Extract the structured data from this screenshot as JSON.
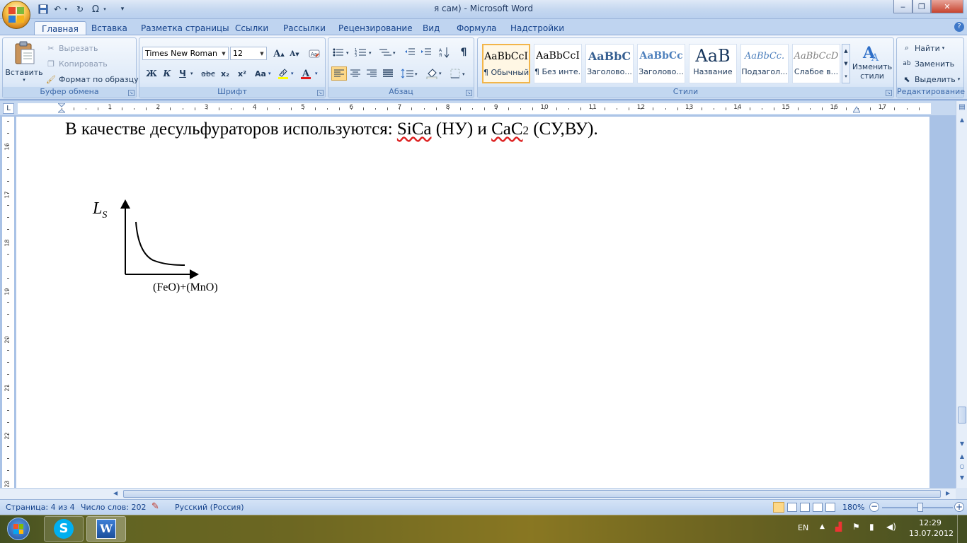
{
  "window": {
    "title": "я сам) - Microsoft Word",
    "min": "‒",
    "max": "❐",
    "close": "✕"
  },
  "tabs": [
    {
      "label": "Главная",
      "active": true
    },
    {
      "label": "Вставка"
    },
    {
      "label": "Разметка страницы"
    },
    {
      "label": "Ссылки"
    },
    {
      "label": "Рассылки"
    },
    {
      "label": "Рецензирование"
    },
    {
      "label": "Вид"
    },
    {
      "label": "Формула"
    },
    {
      "label": "Надстройки"
    }
  ],
  "clipboard": {
    "group": "Буфер обмена",
    "paste": "Вставить",
    "cut": "Вырезать",
    "copy": "Копировать",
    "format_painter": "Формат по образцу"
  },
  "font": {
    "group": "Шрифт",
    "name": "Times New Roman",
    "size": "12",
    "bold": "Ж",
    "italic": "К",
    "underline": "Ч",
    "strike": "abc",
    "sub": "x₂",
    "sup": "x²",
    "case": "Aa",
    "grow": "A",
    "shrink": "A"
  },
  "paragraph": {
    "group": "Абзац",
    "pilcrow": "¶"
  },
  "styles": {
    "group": "Стили",
    "change": "Изменить стили",
    "tiles": [
      {
        "sample": "AaBbCcI",
        "name": "¶ Обычный"
      },
      {
        "sample": "AaBbCcI",
        "name": "¶ Без инте..."
      },
      {
        "sample": "AaBbC",
        "name": "Заголово..."
      },
      {
        "sample": "AaBbCc",
        "name": "Заголово..."
      },
      {
        "sample": "AaB",
        "name": "Название"
      },
      {
        "sample": "AaBbCc.",
        "name": "Подзагол..."
      },
      {
        "sample": "AaBbCcD",
        "name": "Слабое в..."
      }
    ]
  },
  "editing": {
    "group": "Редактирование",
    "find": "Найти",
    "replace": "Заменить",
    "select": "Выделить"
  },
  "ruler": {
    "h_ticks": [
      "1",
      "2",
      "3",
      "4",
      "5",
      "6",
      "7",
      "8",
      "9",
      "10",
      "11",
      "12",
      "13",
      "14",
      "15",
      "16",
      "17"
    ],
    "v_ticks": [
      "16",
      "17",
      "18",
      "19",
      "20",
      "21",
      "22",
      "23"
    ]
  },
  "document": {
    "line_pre": "В качестве десульфураторов используются: ",
    "sica": "SiCa",
    "mid1": " (НУ) и ",
    "cac": "CaC",
    "sub2": "2",
    "tail": " (СУ,ВУ).",
    "y_label": "L",
    "y_sub": "S",
    "x_label": "(FeO)+(MnO)"
  },
  "status": {
    "page": "Страница: 4 из 4",
    "words": "Число слов: 202",
    "lang": "Русский (Россия)",
    "zoom": "180%"
  },
  "tray": {
    "lang": "EN",
    "time": "12:29",
    "date": "13.07.2012"
  }
}
